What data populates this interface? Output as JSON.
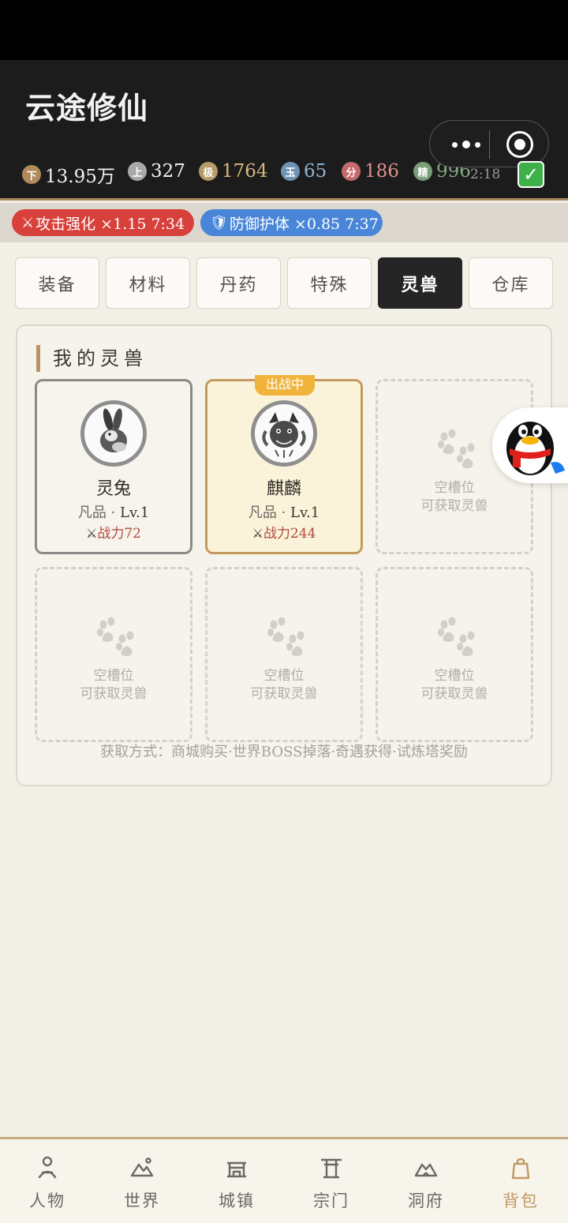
{
  "app": {
    "title": "云途修仙"
  },
  "currencies": [
    {
      "badge": "下",
      "value": "13.95万",
      "color": "#b08a5a",
      "text_color": "#f1f1f1"
    },
    {
      "badge": "上",
      "value": "327",
      "color": "#a9a9a9",
      "text_color": "#f1f1f1"
    },
    {
      "badge": "极",
      "value": "1764",
      "color": "#b79a6a",
      "text_color": "#d8b77e"
    },
    {
      "badge": "玉",
      "value": "65",
      "color": "#6f94b3",
      "text_color": "#8fb6d6"
    },
    {
      "badge": "分",
      "value": "186",
      "color": "#c46a6a",
      "text_color": "#e08f8f"
    },
    {
      "badge": "精",
      "value": "996",
      "color": "#7a9e78",
      "text_color": "#86a884"
    }
  ],
  "status": {
    "timer": "2:18"
  },
  "buffs": [
    {
      "icon": "⚔",
      "label": "攻击强化 ×1.15 7:34",
      "color": "#d8403b"
    },
    {
      "icon": "🛡",
      "label": "防御护体 ×0.85 7:37",
      "color": "#4a86d8"
    }
  ],
  "tabs": [
    {
      "label": "装备",
      "active": false
    },
    {
      "label": "材料",
      "active": false
    },
    {
      "label": "丹药",
      "active": false
    },
    {
      "label": "特殊",
      "active": false
    },
    {
      "label": "灵兽",
      "active": true
    },
    {
      "label": "仓库",
      "active": false
    }
  ],
  "pets_section": {
    "title": "我的灵兽",
    "pets": [
      {
        "name": "灵兔",
        "grade": "凡品",
        "level": "Lv.1",
        "power_label": "战力72",
        "deployed": false
      },
      {
        "name": "麒麟",
        "grade": "凡品",
        "level": "Lv.1",
        "power_label": "战力244",
        "deployed": true,
        "badge": "出战中"
      }
    ],
    "empty_slot": {
      "title": "空槽位",
      "subtitle": "可获取灵兽"
    },
    "acquire_text": "获取方式：商城购买·世界BOSS掉落·奇遇获得·试炼塔奖励"
  },
  "bottom_nav": [
    {
      "label": "人物",
      "icon": "person-icon",
      "active": false
    },
    {
      "label": "世界",
      "icon": "mountain-icon",
      "active": false
    },
    {
      "label": "城镇",
      "icon": "town-gate-icon",
      "active": false
    },
    {
      "label": "宗门",
      "icon": "torii-icon",
      "active": false
    },
    {
      "label": "洞府",
      "icon": "cave-icon",
      "active": false
    },
    {
      "label": "背包",
      "icon": "bag-icon",
      "active": true
    }
  ]
}
